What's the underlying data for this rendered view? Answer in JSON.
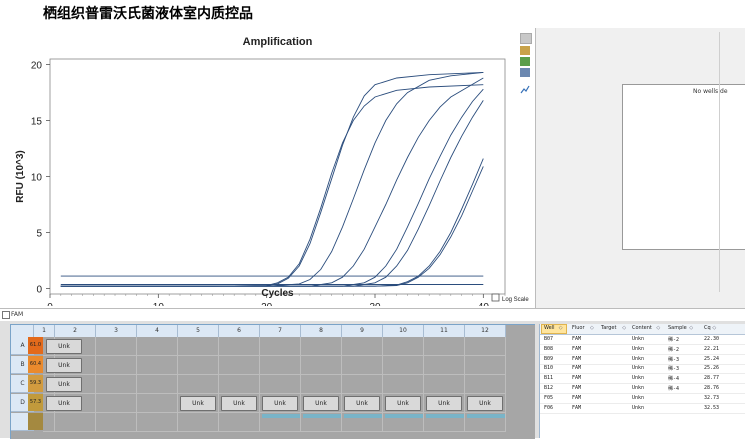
{
  "header": {
    "title": "栖组织普雷沃氏菌液体室内质控品"
  },
  "chart_data": {
    "type": "line",
    "title": "Amplification",
    "xlabel": "Cycles",
    "ylabel": "RFU (10^3)",
    "xlim": [
      0,
      42
    ],
    "ylim": [
      -0.5,
      20.5
    ],
    "xticks": [
      0,
      10,
      20,
      30,
      40
    ],
    "yticks": [
      0,
      5,
      10,
      15,
      20
    ],
    "xtick_labels": [
      "0",
      "10",
      "20",
      "30",
      "40"
    ],
    "ytick_labels": [
      "0",
      "5",
      "10",
      "15",
      "20"
    ],
    "grid": false,
    "line_color": "#2b4d7d",
    "series": [
      {
        "points": [
          [
            1,
            0.2
          ],
          [
            5,
            0.2
          ],
          [
            10,
            0.2
          ],
          [
            15,
            0.2
          ],
          [
            20,
            0.25
          ],
          [
            21,
            0.4
          ],
          [
            22,
            0.9
          ],
          [
            23,
            2
          ],
          [
            24,
            4
          ],
          [
            25,
            6.8
          ],
          [
            26,
            9.8
          ],
          [
            27,
            12.8
          ],
          [
            28,
            15.3
          ],
          [
            29,
            17.2
          ],
          [
            30,
            18.2
          ],
          [
            32,
            18.8
          ],
          [
            35,
            19.1
          ],
          [
            40,
            19.3
          ]
        ]
      },
      {
        "points": [
          [
            1,
            0.2
          ],
          [
            5,
            0.2
          ],
          [
            10,
            0.2
          ],
          [
            15,
            0.2
          ],
          [
            20,
            0.25
          ],
          [
            21,
            0.5
          ],
          [
            22,
            1
          ],
          [
            23,
            2.2
          ],
          [
            24,
            4.4
          ],
          [
            25,
            7.2
          ],
          [
            26,
            10.3
          ],
          [
            27,
            13
          ],
          [
            28,
            15
          ],
          [
            29,
            16.3
          ],
          [
            30,
            17.1
          ],
          [
            32,
            17.7
          ],
          [
            35,
            18
          ],
          [
            40,
            18.2
          ]
        ]
      },
      {
        "points": [
          [
            1,
            0.2
          ],
          [
            10,
            0.2
          ],
          [
            20,
            0.2
          ],
          [
            23,
            0.4
          ],
          [
            24,
            0.8
          ],
          [
            25,
            1.7
          ],
          [
            26,
            3.3
          ],
          [
            27,
            5.5
          ],
          [
            28,
            8
          ],
          [
            29,
            10.6
          ],
          [
            30,
            13
          ],
          [
            31,
            15
          ],
          [
            32,
            16.5
          ],
          [
            33,
            17.5
          ],
          [
            35,
            18.6
          ],
          [
            37,
            19
          ],
          [
            40,
            19.3
          ]
        ]
      },
      {
        "points": [
          [
            1,
            0.2
          ],
          [
            10,
            0.2
          ],
          [
            20,
            0.2
          ],
          [
            24,
            0.2
          ],
          [
            26,
            0.5
          ],
          [
            27,
            1
          ],
          [
            28,
            2
          ],
          [
            29,
            3.5
          ],
          [
            30,
            5.5
          ],
          [
            31,
            7.5
          ],
          [
            32,
            9.7
          ],
          [
            33,
            11.7
          ],
          [
            34,
            13.5
          ],
          [
            35,
            15
          ],
          [
            36,
            16.2
          ],
          [
            37,
            17.1
          ],
          [
            40,
            18.8
          ]
        ]
      },
      {
        "points": [
          [
            1,
            0.2
          ],
          [
            10,
            0.2
          ],
          [
            20,
            0.2
          ],
          [
            27,
            0.2
          ],
          [
            29,
            0.5
          ],
          [
            30,
            1
          ],
          [
            31,
            2
          ],
          [
            32,
            3.5
          ],
          [
            33,
            5.5
          ],
          [
            34,
            7.6
          ],
          [
            35,
            9.8
          ],
          [
            36,
            11.8
          ],
          [
            37,
            13.7
          ],
          [
            38,
            15.3
          ],
          [
            39,
            16.7
          ],
          [
            40,
            17.8
          ]
        ]
      },
      {
        "points": [
          [
            1,
            0.2
          ],
          [
            10,
            0.2
          ],
          [
            20,
            0.2
          ],
          [
            28,
            0.2
          ],
          [
            30,
            0.5
          ],
          [
            31,
            1
          ],
          [
            32,
            2
          ],
          [
            33,
            3.4
          ],
          [
            34,
            5.3
          ],
          [
            35,
            7.4
          ],
          [
            36,
            9.6
          ],
          [
            37,
            11.7
          ],
          [
            38,
            13.6
          ],
          [
            39,
            15.3
          ],
          [
            40,
            16.8
          ]
        ]
      },
      {
        "points": [
          [
            1,
            0.2
          ],
          [
            10,
            0.2
          ],
          [
            20,
            0.2
          ],
          [
            30,
            0.2
          ],
          [
            32,
            0.3
          ],
          [
            33,
            0.6
          ],
          [
            34,
            1.1
          ],
          [
            35,
            2
          ],
          [
            36,
            3.3
          ],
          [
            37,
            5
          ],
          [
            38,
            7.1
          ],
          [
            39,
            9.3
          ],
          [
            40,
            11.6
          ]
        ]
      },
      {
        "points": [
          [
            1,
            0.2
          ],
          [
            10,
            0.2
          ],
          [
            20,
            0.2
          ],
          [
            30,
            0.2
          ],
          [
            32,
            0.25
          ],
          [
            33,
            0.5
          ],
          [
            34,
            1
          ],
          [
            35,
            1.8
          ],
          [
            36,
            3
          ],
          [
            37,
            4.6
          ],
          [
            38,
            6.5
          ],
          [
            39,
            8.7
          ],
          [
            40,
            10.9
          ]
        ]
      },
      {
        "points": [
          [
            1,
            0.35
          ],
          [
            10,
            0.35
          ],
          [
            20,
            0.35
          ],
          [
            30,
            0.35
          ],
          [
            40,
            0.35
          ]
        ]
      },
      {
        "points": [
          [
            1,
            1.1
          ],
          [
            10,
            1.1
          ],
          [
            20,
            1.1
          ],
          [
            30,
            1.1
          ],
          [
            40,
            1.1
          ]
        ]
      }
    ]
  },
  "log_scale": {
    "label": "Log Scale",
    "checked": false
  },
  "right_panel": {
    "message": "No wells de"
  },
  "fluor_bar": {
    "label": "FAM",
    "checked": true
  },
  "plate": {
    "columns": [
      "1",
      "2",
      "3",
      "4",
      "5",
      "6",
      "7",
      "8",
      "9",
      "10",
      "11",
      "12"
    ],
    "rows": [
      {
        "label": "A",
        "temp": "61.0",
        "temp_color": "#e36a1b",
        "wells": {
          "1": "Unk"
        }
      },
      {
        "label": "B",
        "temp": "60.4",
        "temp_color": "#ea8a2d",
        "wells": {
          "1": "Unk"
        }
      },
      {
        "label": "C",
        "temp": "59.3",
        "temp_color": "#d29b3f",
        "wells": {
          "1": "Unk"
        }
      },
      {
        "label": "D",
        "temp": "57.3",
        "temp_color": "#c19a3c",
        "wells": {
          "1": "Unk",
          "5": "Unk",
          "6": "Unk",
          "7": "Unk",
          "8": "Unk",
          "9": "Unk",
          "10": "Unk",
          "11": "Unk",
          "12": "Unk"
        }
      },
      {
        "label": "",
        "temp": "",
        "temp_color": "#a48940",
        "wells": {}
      }
    ]
  },
  "table": {
    "columns": [
      "Well",
      "Fluor",
      "Target",
      "Content",
      "Sample",
      "Cq"
    ],
    "rows": [
      {
        "well": "B07",
        "fluor": "FAM",
        "target": "",
        "content": "Unkn",
        "sample": "稀-2",
        "cq": "22.30"
      },
      {
        "well": "B08",
        "fluor": "FAM",
        "target": "",
        "content": "Unkn",
        "sample": "稀-2",
        "cq": "22.21"
      },
      {
        "well": "B09",
        "fluor": "FAM",
        "target": "",
        "content": "Unkn",
        "sample": "稀-3",
        "cq": "25.24"
      },
      {
        "well": "B10",
        "fluor": "FAM",
        "target": "",
        "content": "Unkn",
        "sample": "稀-3",
        "cq": "25.26"
      },
      {
        "well": "B11",
        "fluor": "FAM",
        "target": "",
        "content": "Unkn",
        "sample": "稀-4",
        "cq": "28.77"
      },
      {
        "well": "B12",
        "fluor": "FAM",
        "target": "",
        "content": "Unkn",
        "sample": "稀-4",
        "cq": "28.76"
      },
      {
        "well": "F05",
        "fluor": "FAM",
        "target": "",
        "content": "Unkn",
        "sample": "",
        "cq": "32.73"
      },
      {
        "well": "F06",
        "fluor": "FAM",
        "target": "",
        "content": "Unkn",
        "sample": "",
        "cq": "32.53"
      }
    ]
  }
}
